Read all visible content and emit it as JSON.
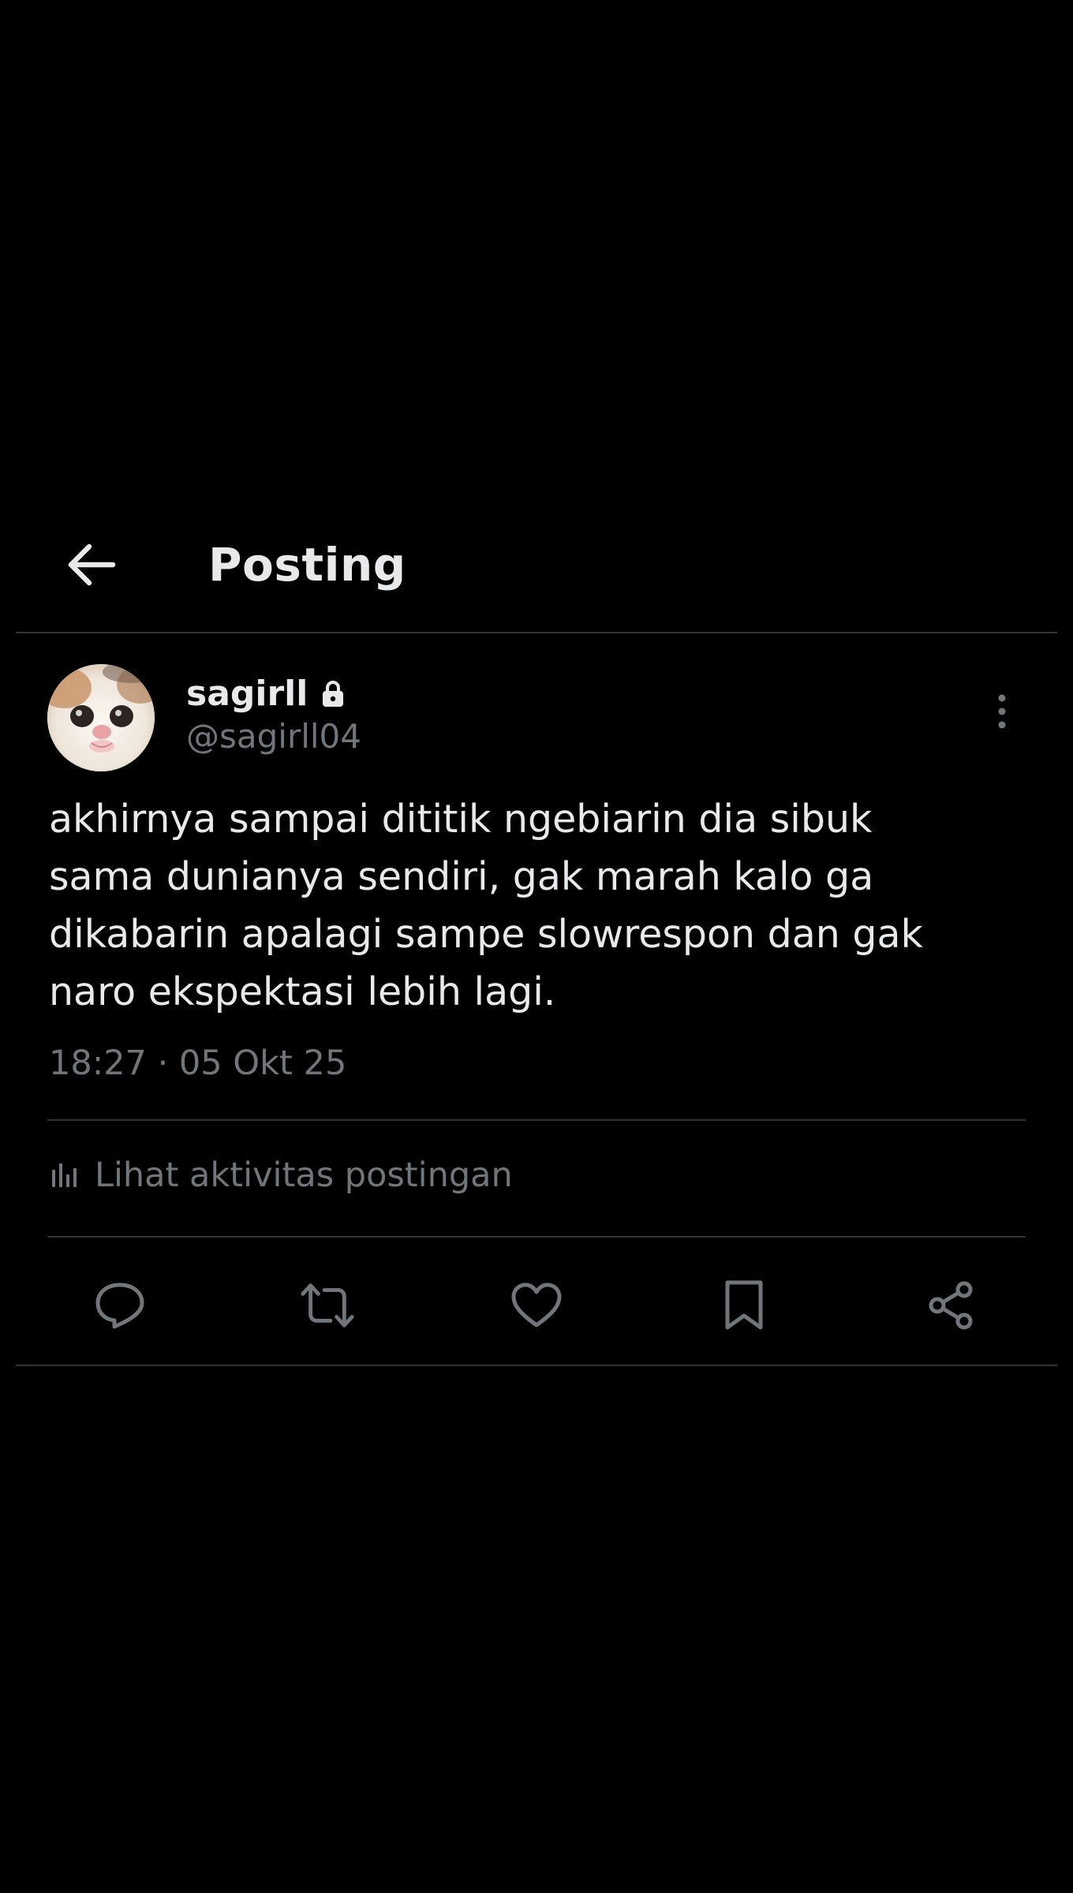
{
  "header": {
    "title": "Posting",
    "back_icon": "arrow-left-icon"
  },
  "post": {
    "author": {
      "display_name": "sagirll",
      "handle": "@sagirll04",
      "protected_icon": "lock-icon",
      "avatar": "cat-face-avatar"
    },
    "text": "akhirnya sampai dititik ngebiarin dia sibuk\nsama dunianya sendiri, gak marah kalo ga\ndikabarin apalagi sampe slowrespon dan gak\nnaro ekspektasi lebih lagi.",
    "timestamp": "18:27 · 05 Okt 25",
    "activity_label": "Lihat aktivitas postingan",
    "actions": [
      "reply-icon",
      "repost-icon",
      "like-icon",
      "bookmark-icon",
      "share-icon"
    ]
  },
  "colors": {
    "background": "#000000",
    "primary_text": "#e7e9ea",
    "secondary_text": "#71767b",
    "divider": "#2f3336"
  }
}
